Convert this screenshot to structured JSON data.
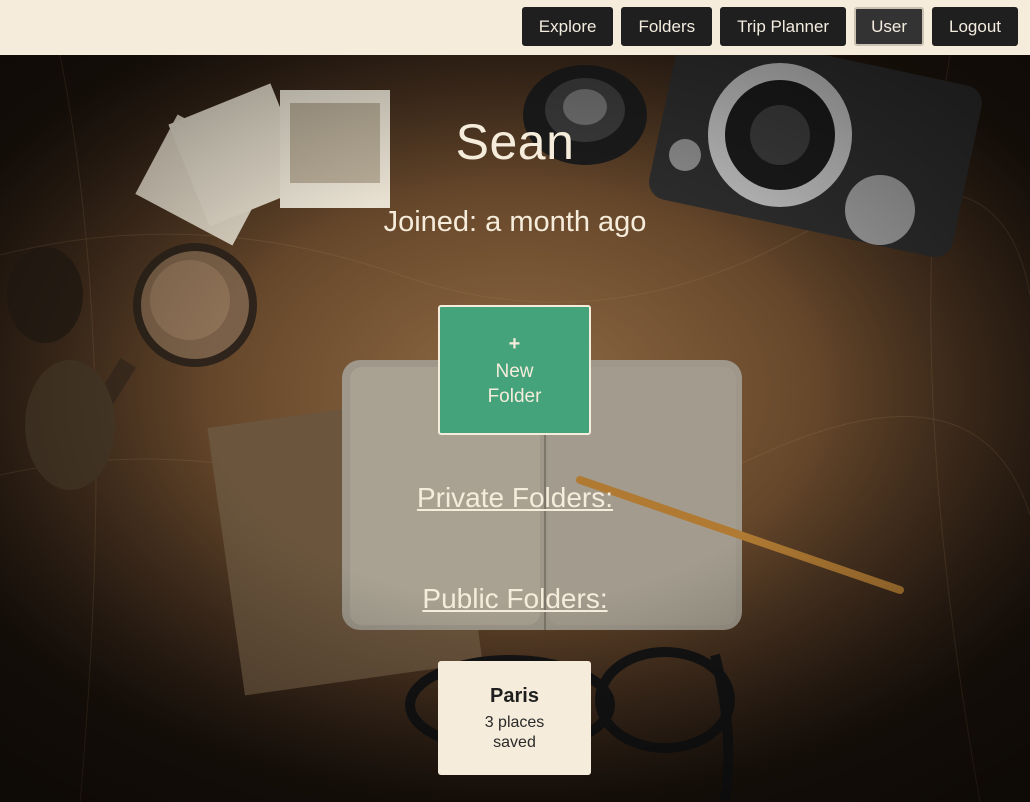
{
  "nav": {
    "items": [
      {
        "label": "Explore"
      },
      {
        "label": "Folders"
      },
      {
        "label": "Trip Planner"
      },
      {
        "label": "User"
      },
      {
        "label": "Logout"
      }
    ],
    "active": "User"
  },
  "profile": {
    "name": "Sean",
    "joined": "Joined: a month ago"
  },
  "new_folder": {
    "icon": "+",
    "label": "New Folder"
  },
  "sections": {
    "private_label": "Private Folders:",
    "public_label": "Public Folders:"
  },
  "public_folders": [
    {
      "name": "Paris",
      "count": "3 places saved"
    }
  ],
  "colors": {
    "topbar": "#f5ecdb",
    "nav_button": "#1f1f1f",
    "accent_green": "#44a37b",
    "text_light": "#f5ecdb"
  }
}
